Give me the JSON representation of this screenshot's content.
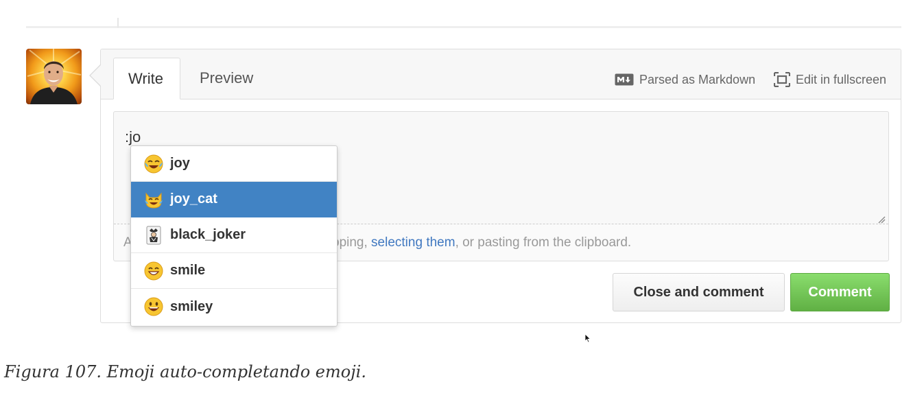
{
  "editor": {
    "tabs": {
      "write": "Write",
      "preview": "Preview"
    },
    "toolbar": {
      "markdown_label": "Parsed as Markdown",
      "fullscreen_label": "Edit in fullscreen",
      "markdown_icon": "markdown-icon",
      "fullscreen_icon": "fullscreen-icon"
    },
    "textarea_value": ":jo",
    "drop_hint": {
      "visible_prefix": "A",
      "visible_middle": "pping, ",
      "link_text": "selecting them",
      "visible_suffix": ", or pasting from the clipboard."
    },
    "buttons": {
      "close_and_comment": "Close and comment",
      "comment": "Comment"
    }
  },
  "autocomplete": {
    "items": [
      {
        "label": "joy",
        "icon": "joy-emoji-icon",
        "selected": false
      },
      {
        "label": "joy_cat",
        "icon": "joy-cat-emoji-icon",
        "selected": true
      },
      {
        "label": "black_joker",
        "icon": "black-joker-emoji-icon",
        "selected": false
      },
      {
        "label": "smile",
        "icon": "smile-emoji-icon",
        "selected": false
      },
      {
        "label": "smiley",
        "icon": "smiley-emoji-icon",
        "selected": false
      }
    ]
  },
  "colors": {
    "accent_blue": "#4183c4",
    "comment_green": "#60b044",
    "link_blue": "#4078c0"
  },
  "caption": "Figura 107. Emoji auto-completando emoji."
}
